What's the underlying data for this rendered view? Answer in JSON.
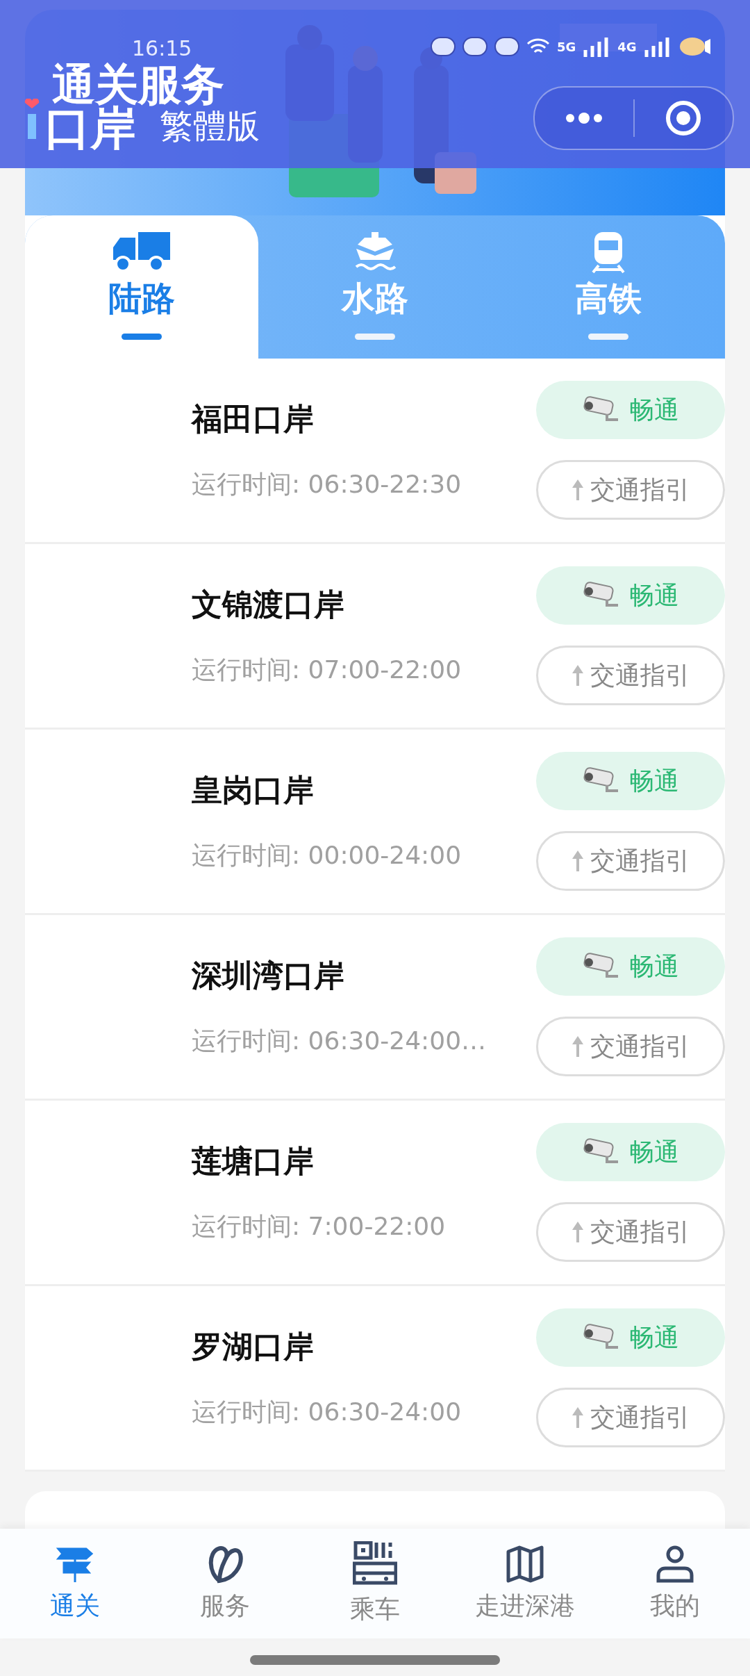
{
  "status_bar": {
    "time": "16:15",
    "networks": [
      "5G",
      "4G"
    ]
  },
  "header": {
    "title": "通关服务",
    "logo": "口岸",
    "edition": "繁體版"
  },
  "tabs": [
    {
      "label": "陆路",
      "kind": "truck",
      "selected": true
    },
    {
      "label": "水路",
      "kind": "ship",
      "selected": false
    },
    {
      "label": "高铁",
      "kind": "train",
      "selected": false
    }
  ],
  "ports": [
    {
      "name": "福田口岸",
      "hours": "运行时间: 06:30-22:30",
      "status": "畅通",
      "guide": "交通指引"
    },
    {
      "name": "文锦渡口岸",
      "hours": "运行时间: 07:00-22:00",
      "status": "畅通",
      "guide": "交通指引"
    },
    {
      "name": "皇岗口岸",
      "hours": "运行时间: 00:00-24:00",
      "status": "畅通",
      "guide": "交通指引"
    },
    {
      "name": "深圳湾口岸",
      "hours": "运行时间: 06:30-24:00…",
      "status": "畅通",
      "guide": "交通指引"
    },
    {
      "name": "莲塘口岸",
      "hours": "运行时间: 7:00-22:00",
      "status": "畅通",
      "guide": "交通指引"
    },
    {
      "name": "罗湖口岸",
      "hours": "运行时间: 06:30-24:00",
      "status": "畅通",
      "guide": "交通指引"
    }
  ],
  "bottom_nav": [
    {
      "label": "通关",
      "kind": "signpost",
      "selected": true
    },
    {
      "label": "服务",
      "kind": "leaf",
      "selected": false
    },
    {
      "label": "乘车",
      "kind": "bus",
      "selected": false
    },
    {
      "label": "走进深港",
      "kind": "map",
      "selected": false
    },
    {
      "label": "我的",
      "kind": "user",
      "selected": false
    }
  ]
}
